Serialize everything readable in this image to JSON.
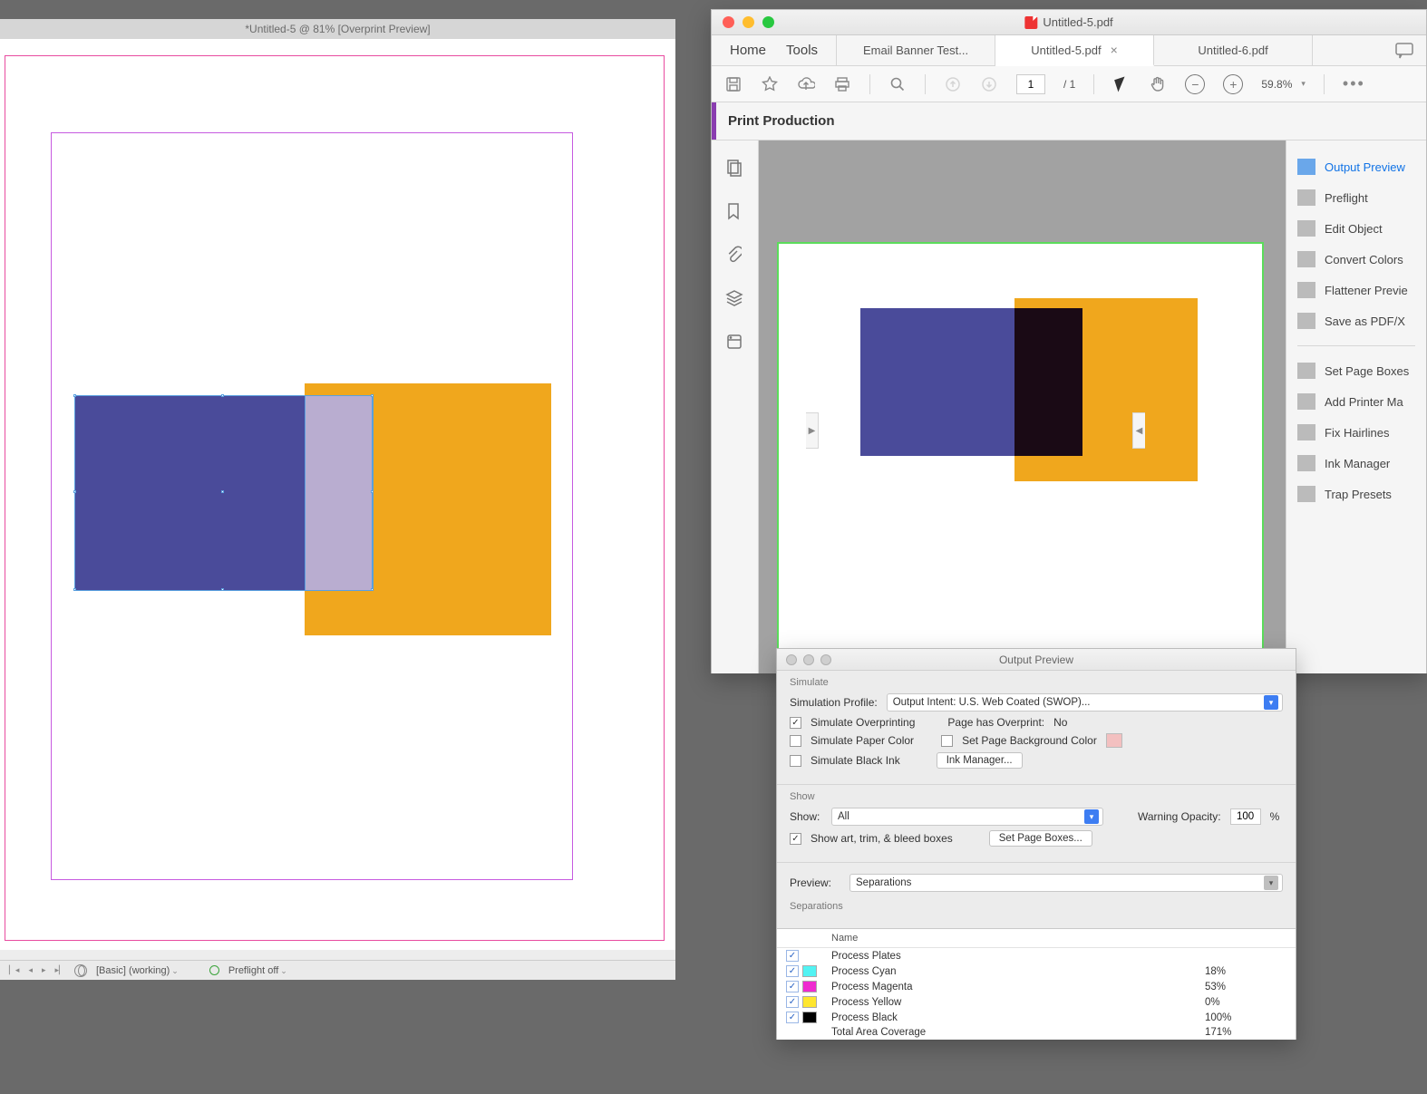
{
  "indesign": {
    "title": "*Untitled-5 @ 81% [Overprint Preview]",
    "status": {
      "preset": "[Basic] (working)",
      "preflight": "Preflight off"
    },
    "colors": {
      "purple": "#4a4b9a",
      "orange": "#f0a71d",
      "overlap": "#b9add0"
    }
  },
  "acrobat": {
    "window_title": "Untitled-5.pdf",
    "nav": {
      "home": "Home",
      "tools": "Tools"
    },
    "tabs": [
      {
        "label": "Email Banner Test...",
        "active": false,
        "closable": false
      },
      {
        "label": "Untitled-5.pdf",
        "active": true,
        "closable": true
      },
      {
        "label": "Untitled-6.pdf",
        "active": false,
        "closable": false
      }
    ],
    "page": {
      "current": "1",
      "total": "/  1"
    },
    "zoom": "59.8%",
    "panel_header": "Print Production",
    "right_rail": {
      "items_a": [
        "Output Preview",
        "Preflight",
        "Edit Object",
        "Convert Colors",
        "Flattener Previe",
        "Save as PDF/X"
      ],
      "items_b": [
        "Set Page Boxes",
        "Add Printer Ma",
        "Fix Hairlines",
        "Ink Manager",
        "Trap Presets"
      ]
    },
    "page_colors": {
      "purple": "#4a4b9a",
      "orange": "#f0a71d",
      "overlap": "#1a0a15",
      "border": "#5bdc5b"
    }
  },
  "output_preview": {
    "title": "Output Preview",
    "simulate": {
      "label": "Simulate",
      "profile_label": "Simulation Profile:",
      "profile_value": "Output Intent: U.S. Web Coated (SWOP)...",
      "simulate_overprinting": "Simulate Overprinting",
      "page_has_overprint_label": "Page has Overprint:",
      "page_has_overprint_value": "No",
      "simulate_paper_color": "Simulate Paper Color",
      "set_bg": "Set Page Background Color",
      "simulate_black_ink": "Simulate Black Ink",
      "ink_manager_btn": "Ink Manager..."
    },
    "show": {
      "label": "Show",
      "show_label": "Show:",
      "show_value": "All",
      "warning_label": "Warning Opacity:",
      "warning_value": "100",
      "pct": "%",
      "art_boxes": "Show art, trim, & bleed boxes",
      "set_boxes_btn": "Set Page Boxes..."
    },
    "preview": {
      "label": "Preview:",
      "value": "Separations"
    },
    "separations": {
      "label": "Separations",
      "header_name": "Name",
      "rows": [
        {
          "name": "Process Plates",
          "value": "",
          "color": null
        },
        {
          "name": "Process Cyan",
          "value": "18%",
          "color": "#52f3f3"
        },
        {
          "name": "Process Magenta",
          "value": "53%",
          "color": "#ef2bd0"
        },
        {
          "name": "Process Yellow",
          "value": "0%",
          "color": "#ffe62e"
        },
        {
          "name": "Process Black",
          "value": "100%",
          "color": "#000000"
        },
        {
          "name": "Total Area Coverage",
          "value": "171%",
          "color": null
        }
      ]
    }
  }
}
